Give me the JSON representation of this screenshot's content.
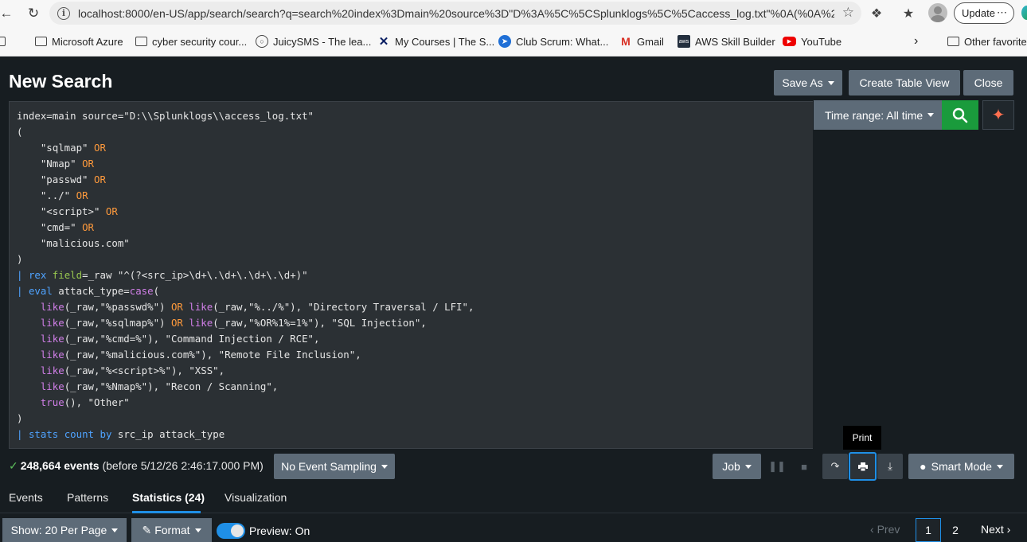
{
  "browser": {
    "url": "localhost:8000/en-US/app/search/search?q=search%20index%3Dmain%20source%3D\"D%3A%5C%5CSplunklogs%5C%5Caccess_log.txt\"%0A(%0A%20...",
    "update_label": "Update",
    "bookmarks": [
      {
        "label": "Microsoft Azure",
        "icon": "folder-icon"
      },
      {
        "label": "cyber security cour...",
        "icon": "folder-icon"
      },
      {
        "label": "JuicySMS - The lea...",
        "icon": "globe-icon"
      },
      {
        "label": "My Courses | The S...",
        "icon": "x-icon"
      },
      {
        "label": "Club Scrum: What...",
        "icon": "club-icon"
      },
      {
        "label": "Gmail",
        "icon": "gmail-icon"
      },
      {
        "label": "AWS Skill Builder",
        "icon": "aws-icon"
      },
      {
        "label": "YouTube",
        "icon": "youtube-icon"
      }
    ],
    "other_favorites": "Other favorites"
  },
  "header": {
    "title": "New Search",
    "save_as": "Save As",
    "create_table_view": "Create Table View",
    "close": "Close"
  },
  "search": {
    "time_range": "Time range: All time",
    "query_lines": [
      "index=main source=\"D:\\\\Splunklogs\\\\access_log.txt\"",
      "(",
      "    \"sqlmap\" OR",
      "    \"Nmap\" OR",
      "    \"passwd\" OR",
      "    \"../\" OR",
      "    \"<script>\" OR",
      "    \"cmd=\" OR",
      "    \"malicious.com\"",
      ")",
      "| rex field=_raw \"^(?<src_ip>\\d+\\.\\d+\\.\\d+\\.\\d+)\"",
      "| eval attack_type=case(",
      "    like(_raw,\"%passwd%\") OR like(_raw,\"%../%\"), \"Directory Traversal / LFI\",",
      "    like(_raw,\"%sqlmap%\") OR like(_raw,\"%OR%1%=1%\"), \"SQL Injection\",",
      "    like(_raw,\"%cmd=%\"), \"Command Injection / RCE\",",
      "    like(_raw,\"%malicious.com%\"), \"Remote File Inclusion\",",
      "    like(_raw,\"%<script>%\"), \"XSS\",",
      "    like(_raw,\"%Nmap%\"), \"Recon / Scanning\",",
      "    true(), \"Other\"",
      ")",
      "| stats count by src_ip attack_type"
    ]
  },
  "status": {
    "event_count": "248,664 events",
    "event_suffix": "(before 5/12/26 2:46:17.000 PM)",
    "sampling": "No Event Sampling",
    "job": "Job",
    "tooltip": "Print",
    "smart_mode": "Smart Mode"
  },
  "tabs": [
    "Events",
    "Patterns",
    "Statistics (24)",
    "Visualization"
  ],
  "results": {
    "per_page": "Show: 20 Per Page",
    "format": "Format",
    "preview": "Preview: On",
    "prev": "Prev",
    "pages": [
      "1",
      "2"
    ],
    "next": "Next"
  },
  "colors": {
    "accent": "#1f8fe6",
    "search_green": "#1a9b3c",
    "keyword_orange": "#ff9a3c",
    "command_blue": "#4fa3ff",
    "function_purple": "#d17fe8"
  }
}
